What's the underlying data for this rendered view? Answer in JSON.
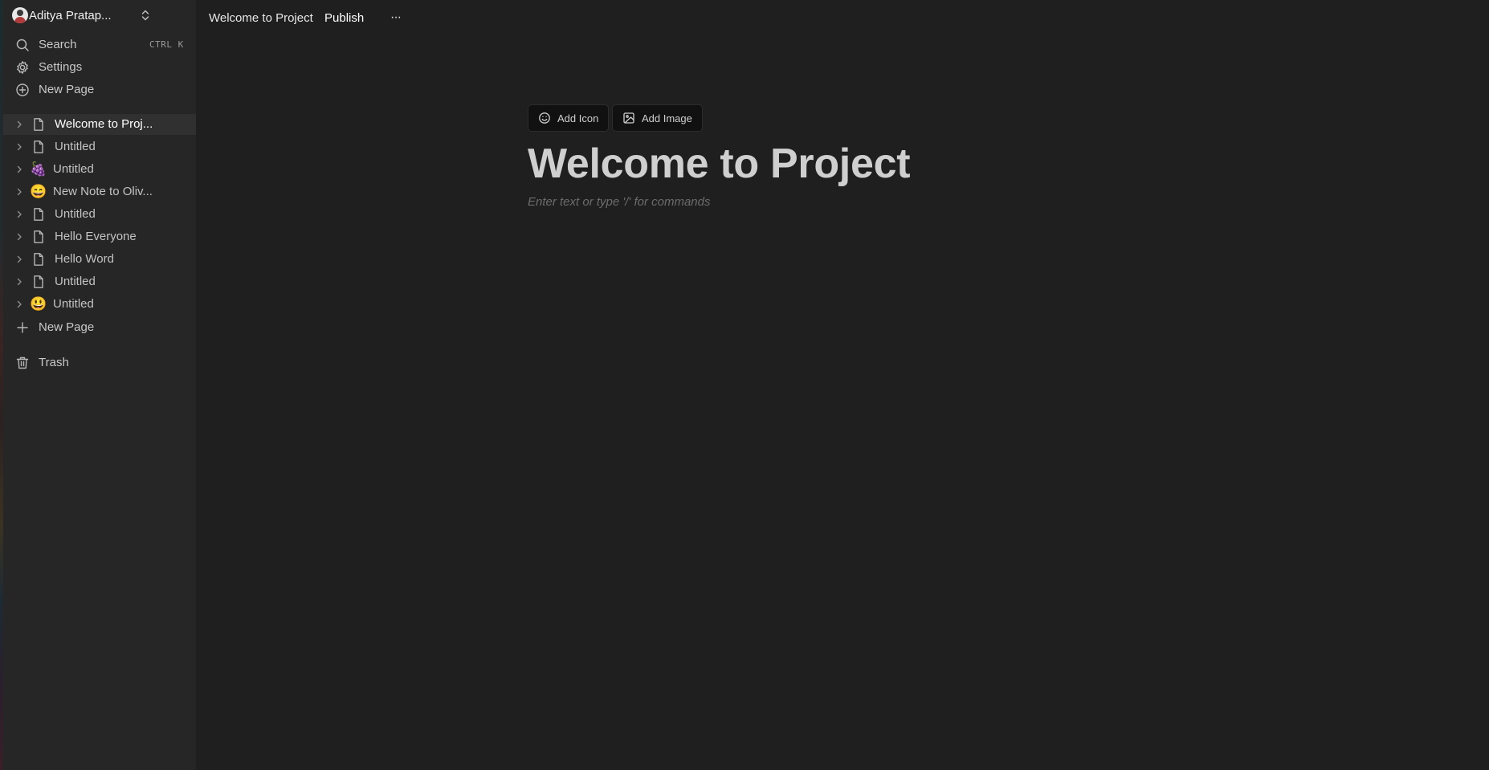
{
  "sidebar": {
    "user_name": "Aditya Pratap...",
    "search": {
      "label": "Search",
      "shortcut": "CTRL K"
    },
    "settings_label": "Settings",
    "new_page_label": "New Page",
    "pages": [
      {
        "label": "Welcome to Proj...",
        "icon": "page-icon",
        "active": true
      },
      {
        "label": "Untitled",
        "icon": "page-icon"
      },
      {
        "label": "Untitled",
        "icon": "grapes-emoji",
        "emoji": "🍇"
      },
      {
        "label": "New Note to Oliv...",
        "icon": "grinning-emoji",
        "emoji": "😄"
      },
      {
        "label": "Untitled",
        "icon": "page-icon"
      },
      {
        "label": "Hello Everyone",
        "icon": "page-icon"
      },
      {
        "label": "Hello Word",
        "icon": "page-icon"
      },
      {
        "label": "Untitled",
        "icon": "page-icon"
      },
      {
        "label": "Untitled",
        "icon": "smiley-emoji",
        "emoji": "😃"
      }
    ],
    "add_page_label": "New Page",
    "trash_label": "Trash"
  },
  "header": {
    "title": "Welcome to Project",
    "publish_label": "Publish",
    "more_label": "···"
  },
  "editor": {
    "add_icon_label": "Add Icon",
    "add_image_label": "Add Image",
    "title": "Welcome to Project",
    "placeholder": "Enter text or type '/' for commands"
  },
  "colors": {
    "background": "#1f1f1f",
    "sidebar": "#262626",
    "active_item": "#303030",
    "button_bg": "#111111"
  }
}
